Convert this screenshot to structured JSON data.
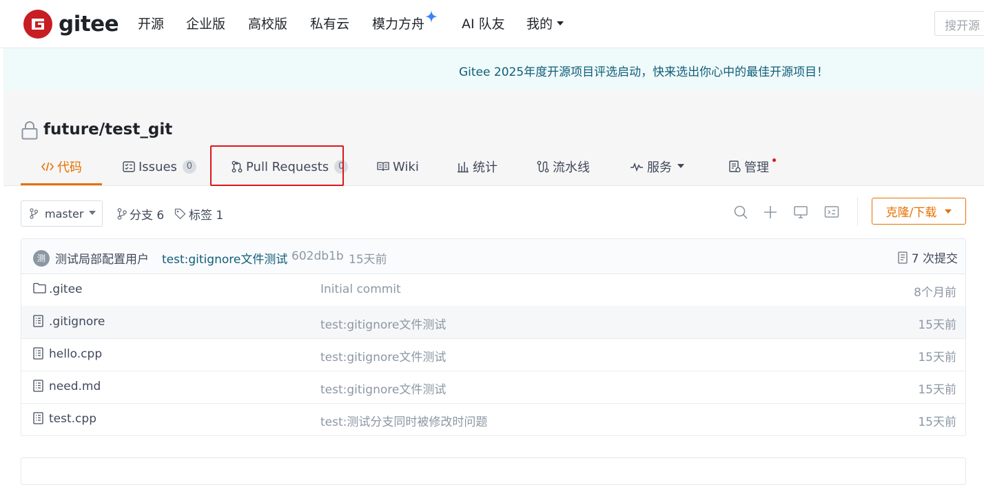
{
  "nav": {
    "brand": "gitee",
    "items": [
      "开源",
      "企业版",
      "高校版",
      "私有云",
      "模力方舟",
      "AI 队友",
      "我的"
    ],
    "search_placeholder": "搜开源"
  },
  "banner": {
    "text": "Gitee 2025年度开源项目评选启动，快来选出你心中的最佳开源项目！"
  },
  "repo": {
    "title": "future/test_git",
    "tabs": [
      {
        "label": "代码",
        "icon": "code-icon",
        "active": true
      },
      {
        "label": "Issues",
        "count": "0",
        "icon": "issues-icon"
      },
      {
        "label": "Pull Requests",
        "count": "0",
        "icon": "pull-request-icon"
      },
      {
        "label": "Wiki",
        "icon": "book-icon"
      },
      {
        "label": "统计",
        "icon": "stats-icon"
      },
      {
        "label": "流水线",
        "icon": "pipeline-icon"
      },
      {
        "label": "服务",
        "icon": "pulse-icon"
      },
      {
        "label": "管理",
        "icon": "manage-icon"
      }
    ]
  },
  "toolbar": {
    "branch": "master",
    "branches": "分支 6",
    "tags": "标签 1",
    "clone_label": "克隆/下载"
  },
  "commit": {
    "avatar_char": "测",
    "author": "测试局部配置用户",
    "message": "test:gitignore文件测试",
    "sha": "602db1b",
    "ago": "15天前",
    "count_label": "7 次提交"
  },
  "files": [
    {
      "name": ".gitee",
      "type": "folder",
      "message": "Initial commit",
      "time": "8个月前"
    },
    {
      "name": ".gitignore",
      "type": "file",
      "message": "test:gitignore文件测试",
      "time": "15天前"
    },
    {
      "name": "hello.cpp",
      "type": "file",
      "message": "test:gitignore文件测试",
      "time": "15天前"
    },
    {
      "name": "need.md",
      "type": "file",
      "message": "test:gitignore文件测试",
      "time": "15天前"
    },
    {
      "name": "test.cpp",
      "type": "file",
      "message": "test:测试分支同时被修改时问题",
      "time": "15天前"
    }
  ],
  "colors": {
    "accent": "#e76f00",
    "brand_red": "#c71d23",
    "link": "#0f5d7a",
    "highlight_box": "#e0131b",
    "banner_bg": "#effafa"
  }
}
